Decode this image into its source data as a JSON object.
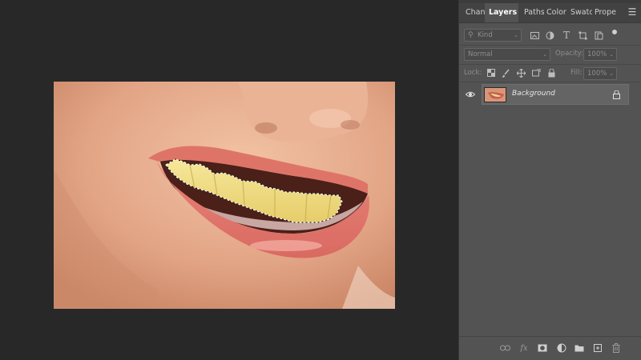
{
  "panel": {
    "tabs": [
      {
        "label": "Chann",
        "active": false
      },
      {
        "label": "Layers",
        "active": true
      },
      {
        "label": "Paths",
        "active": false
      },
      {
        "label": "Color",
        "active": false
      },
      {
        "label": "Swatc",
        "active": false
      },
      {
        "label": "Prope",
        "active": false
      }
    ],
    "menu_icon": "hamburger-menu-icon",
    "filter": {
      "placeholder": "Kind",
      "icons": [
        "image-filter-icon",
        "adjustment-filter-icon",
        "type-filter-icon",
        "shape-filter-icon",
        "smart-object-filter-icon",
        "filter-toggle-dot"
      ]
    },
    "blend_mode": "Normal",
    "opacity_label": "Opacity:",
    "opacity_value": "100%",
    "lock_label": "Lock:",
    "fill_label": "Fill:",
    "fill_value": "100%",
    "layers": [
      {
        "name": "Background",
        "visible": true,
        "locked": true
      }
    ],
    "bottom_icons": [
      "link-layers-icon",
      "fx-icon",
      "add-mask-icon",
      "adjustment-layer-icon",
      "new-group-icon",
      "new-layer-icon",
      "delete-layer-icon"
    ]
  },
  "colors": {
    "workspace": "#282828",
    "panel": "#535353",
    "selected_layer": "#646464"
  }
}
